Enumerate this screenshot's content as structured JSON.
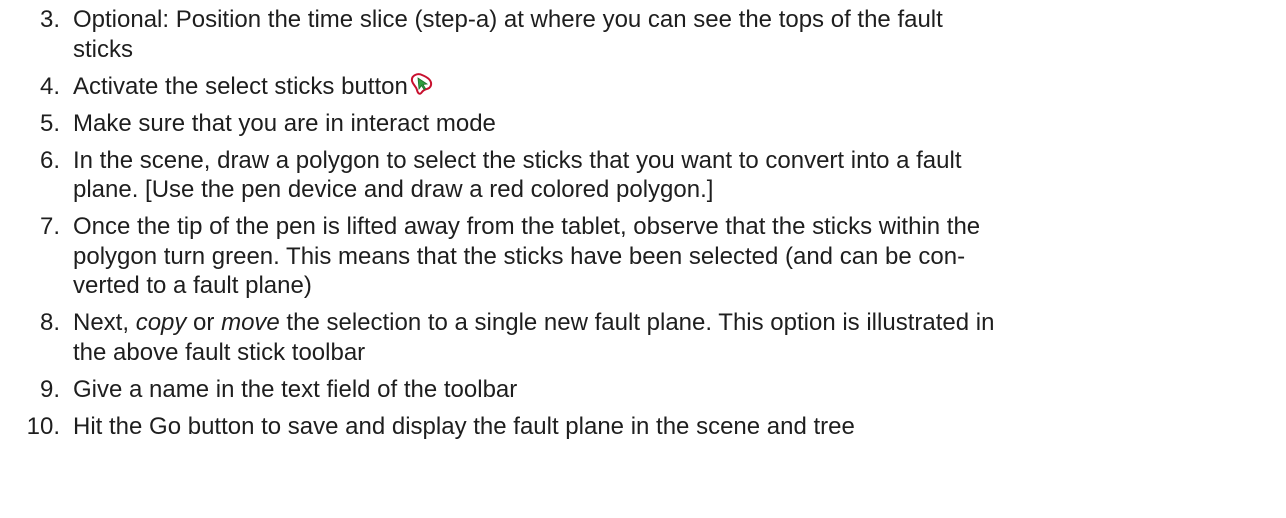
{
  "steps": [
    {
      "number": "3.",
      "text": "Optional: Position the time slice (step-a) at where you can see the tops of the fault",
      "cont": "sticks"
    },
    {
      "number": "4.",
      "text": "Activate the select sticks button",
      "icon": "select-sticks-icon"
    },
    {
      "number": "5.",
      "text": "Make sure that you are in interact mode"
    },
    {
      "number": "6.",
      "text": "In the scene, draw a polygon to select the sticks that you want to convert into a fault",
      "cont": "plane. [Use the pen device and draw a red colored polygon.]"
    },
    {
      "number": "7.",
      "text": "Once the tip of the pen is lifted away from the tablet, observe that the sticks within the",
      "cont": "polygon turn green. This means that the sticks have been selected (and can be con-",
      "cont2": "verted to a fault plane)"
    },
    {
      "number": "8.",
      "pre": "Next, ",
      "em1": "copy",
      "mid": " or ",
      "em2": "move",
      "post": " the selection to a single new fault plane. This option is illustrated in",
      "cont": "the above fault stick toolbar"
    },
    {
      "number": "9.",
      "text": "Give a name in the text field of the toolbar"
    },
    {
      "number": "10.",
      "text": "Hit the Go button to save and display the fault plane in the scene and tree"
    }
  ],
  "colors": {
    "text": "#1e1e1e",
    "icon_outline": "#c8102e",
    "icon_fill": "#2e9e3e"
  }
}
